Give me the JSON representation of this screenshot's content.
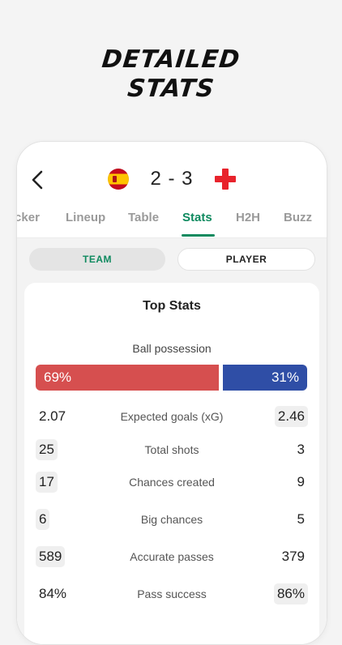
{
  "headline": {
    "line1": "DETAILED",
    "line2": "STATS"
  },
  "match": {
    "score": "2 - 3",
    "home_team": "Spain",
    "away_team": "England"
  },
  "tabs": [
    {
      "label": "Ticker"
    },
    {
      "label": "Lineup"
    },
    {
      "label": "Table"
    },
    {
      "label": "Stats",
      "active": true
    },
    {
      "label": "H2H"
    },
    {
      "label": "Buzz"
    }
  ],
  "segment": {
    "team_label": "TEAM",
    "player_label": "PLAYER",
    "selected": "TEAM"
  },
  "card": {
    "title": "Top Stats",
    "possession": {
      "label": "Ball possession",
      "home": "69%",
      "away": "31%",
      "home_share": 0.69
    },
    "stats": [
      {
        "label": "Expected goals (xG)",
        "home": "2.07",
        "away": "2.46",
        "highlight": "away"
      },
      {
        "label": "Total shots",
        "home": "25",
        "away": "3",
        "highlight": "home"
      },
      {
        "label": "Chances created",
        "home": "17",
        "away": "9",
        "highlight": "home"
      },
      {
        "label": "Big chances",
        "home": "6",
        "away": "5",
        "highlight": "home"
      },
      {
        "label": "Accurate passes",
        "home": "589",
        "away": "379",
        "highlight": "home"
      },
      {
        "label": "Pass success",
        "home": "84%",
        "away": "86%",
        "highlight": "away"
      }
    ]
  },
  "colors": {
    "accent": "#0f8a5f",
    "home": "#d64f4f",
    "away": "#2f4ea6"
  }
}
